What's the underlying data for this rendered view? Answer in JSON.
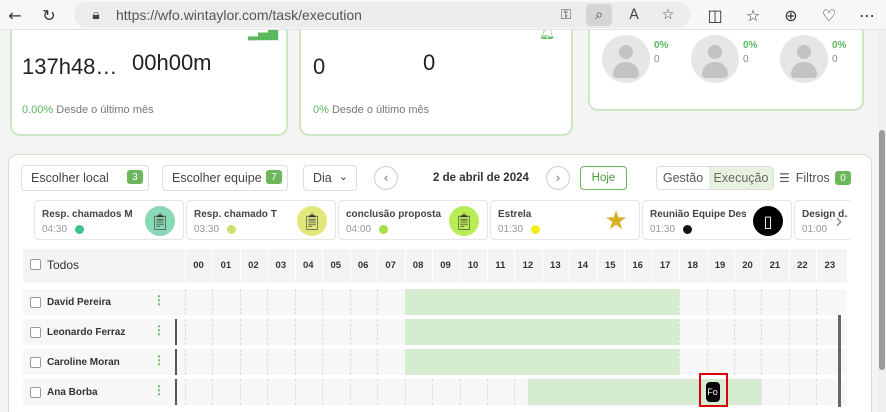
{
  "browser": {
    "url": "https://wfo.wintaylor.com/task/execution"
  },
  "stats": {
    "card1": {
      "value_a": "137h48…",
      "value_b": "00h00m",
      "pct": "0.00%",
      "pct_label": "Desde o último mês"
    },
    "card2": {
      "value_a": "0",
      "value_b": "0",
      "pct": "0%",
      "pct_label": "Desde o último mês"
    },
    "card3": {
      "avatars": [
        {
          "pct": "0%",
          "val": "0"
        },
        {
          "pct": "0%",
          "val": "0"
        },
        {
          "pct": "0%",
          "val": "0"
        }
      ]
    }
  },
  "filters": {
    "local": {
      "label": "Escolher local",
      "count": "3"
    },
    "equipe": {
      "label": "Escolher equipe",
      "count": "7"
    },
    "period": "Dia",
    "date": "2 de abril de 2024",
    "today": "Hoje",
    "gestao": "Gestão",
    "execucao": "Execução",
    "filtros": "Filtros",
    "filtros_count": "0"
  },
  "tasks": [
    {
      "name": "Resp. chamados M",
      "time": "04:30",
      "dot": "#3ec08a",
      "icon_bg": "#8ad9b5",
      "icon": "📋"
    },
    {
      "name": "Resp. chamado T",
      "time": "03:30",
      "dot": "#c9e26b",
      "icon_bg": "#dfe77d",
      "icon": "📋"
    },
    {
      "name": "conclusão proposta c...",
      "time": "04:00",
      "dot": "#a4e04a",
      "icon_bg": "#b9ec57",
      "icon": "📋"
    },
    {
      "name": "Estrela",
      "time": "01:30",
      "dot": "#f2ec1f",
      "icon_bg": "#ffffff",
      "icon": "★"
    },
    {
      "name": "Reunião Equipe Dese...",
      "time": "01:30",
      "dot": "#111111",
      "icon_bg": "#000000",
      "icon": "▯"
    },
    {
      "name": "Design d...",
      "time": "01:00",
      "dot": "#cccccc",
      "icon_bg": "#ffffff",
      "icon": ""
    }
  ],
  "gantt": {
    "all_label": "Todos",
    "hours": [
      "00",
      "01",
      "02",
      "03",
      "04",
      "05",
      "06",
      "07",
      "08",
      "09",
      "10",
      "11",
      "12",
      "13",
      "14",
      "15",
      "16",
      "17",
      "18",
      "19",
      "20",
      "21",
      "22",
      "23"
    ],
    "rows": [
      {
        "name": "David Pereira",
        "start": 8,
        "end": 18
      },
      {
        "name": "Leonardo Ferraz",
        "start": 8,
        "end": 18
      },
      {
        "name": "Caroline Moran",
        "start": 8,
        "end": 18
      },
      {
        "name": "Ana Borba",
        "start": 12.5,
        "end": 21,
        "marker": "Fo"
      }
    ]
  }
}
